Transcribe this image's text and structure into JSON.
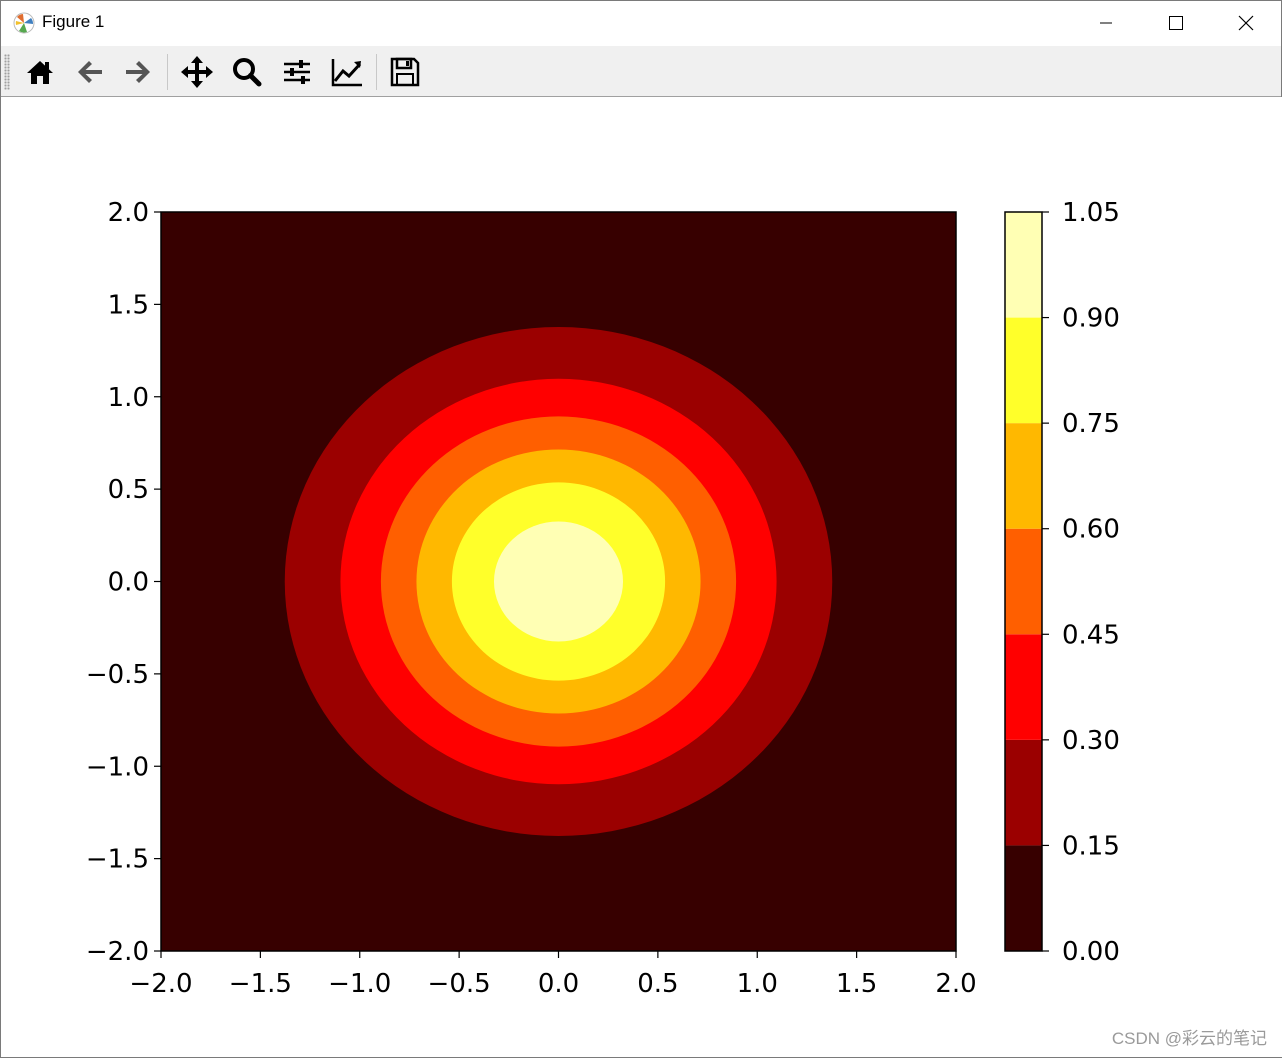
{
  "window": {
    "title": "Figure 1",
    "controls": {
      "minimize_icon": "minimize-icon",
      "maximize_icon": "maximize-icon",
      "close_icon": "close-icon"
    }
  },
  "toolbar": {
    "buttons": [
      {
        "name": "home-button",
        "icon": "home-icon"
      },
      {
        "name": "back-button",
        "icon": "arrow-left-icon"
      },
      {
        "name": "forward-button",
        "icon": "arrow-right-icon"
      },
      {
        "name": "pan-button",
        "icon": "move-icon"
      },
      {
        "name": "zoom-button",
        "icon": "magnifier-icon"
      },
      {
        "name": "subplots-button",
        "icon": "sliders-icon"
      },
      {
        "name": "edit-axes-button",
        "icon": "line-chart-icon"
      },
      {
        "name": "save-button",
        "icon": "floppy-disk-icon"
      }
    ]
  },
  "chart_data": {
    "type": "heatmap",
    "subtype": "filled-contour",
    "function": "z = exp(-(x^2 + y^2))",
    "x_range": [
      -2.0,
      2.0
    ],
    "y_range": [
      -2.0,
      2.0
    ],
    "x_ticks": [
      "−2.0",
      "−1.5",
      "−1.0",
      "−0.5",
      "0.0",
      "0.5",
      "1.0",
      "1.5",
      "2.0"
    ],
    "y_ticks": [
      "−2.0",
      "−1.5",
      "−1.0",
      "−0.5",
      "0.0",
      "0.5",
      "1.0",
      "1.5",
      "2.0"
    ],
    "levels": [
      0.0,
      0.15,
      0.3,
      0.45,
      0.6,
      0.75,
      0.9,
      1.05
    ],
    "level_colors": [
      "#370000",
      "#9b0000",
      "#ff0000",
      "#ff5f00",
      "#ffb800",
      "#ffff2a",
      "#ffffb4"
    ],
    "colorbar": {
      "range": [
        0.0,
        1.05
      ],
      "tick_labels": [
        "0.00",
        "0.15",
        "0.30",
        "0.45",
        "0.60",
        "0.75",
        "0.90",
        "1.05"
      ]
    },
    "colormap": "hot",
    "grid": false,
    "xlabel": "",
    "ylabel": "",
    "title": ""
  },
  "watermark": "CSDN @彩云的笔记"
}
